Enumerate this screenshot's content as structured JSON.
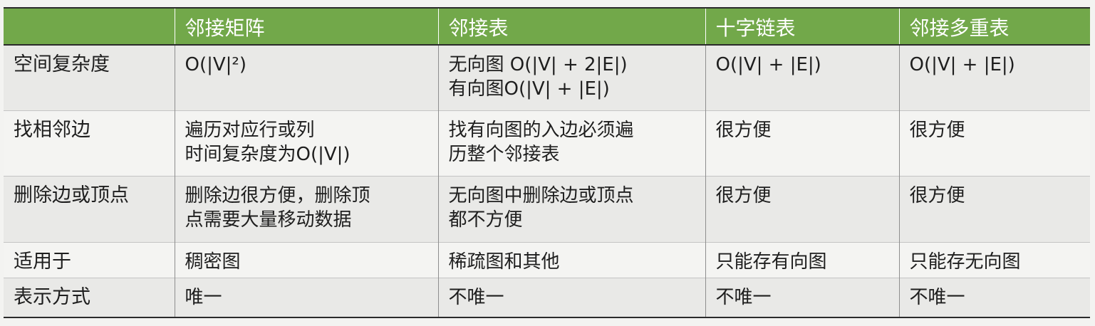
{
  "header": {
    "blank": "",
    "cols": [
      "邻接矩阵",
      "邻接表",
      "十字链表",
      "邻接多重表"
    ]
  },
  "rows": [
    {
      "label": "空间复杂度",
      "cells": [
        [
          "O(|V|²)"
        ],
        [
          "无向图 O(|V| + 2|E|)",
          "有向图O(|V| + |E|)"
        ],
        [
          "O(|V| + |E|)"
        ],
        [
          "O(|V| + |E|)"
        ]
      ]
    },
    {
      "label": "找相邻边",
      "cells": [
        [
          "遍历对应行或列",
          "时间复杂度为O(|V|)"
        ],
        [
          "找有向图的入边必须遍",
          "历整个邻接表"
        ],
        [
          "很方便"
        ],
        [
          "很方便"
        ]
      ]
    },
    {
      "label": "删除边或顶点",
      "cells": [
        [
          "删除边很方便，删除顶",
          "点需要大量移动数据"
        ],
        [
          "无向图中删除边或顶点",
          "都不方便"
        ],
        [
          "很方便"
        ],
        [
          "很方便"
        ]
      ]
    },
    {
      "label": "适用于",
      "cells": [
        [
          "稠密图"
        ],
        [
          "稀疏图和其他"
        ],
        [
          "只能存有向图"
        ],
        [
          "只能存无向图"
        ]
      ]
    },
    {
      "label": "表示方式",
      "cells": [
        [
          "唯一"
        ],
        [
          "不唯一"
        ],
        [
          "不唯一"
        ],
        [
          "不唯一"
        ]
      ]
    }
  ],
  "colors": {
    "header_bg": "#72a84a",
    "header_text": "#ffffff",
    "row_odd_bg": "#e9e9e7",
    "row_even_bg": "#f4f4f2",
    "text": "#1e1e1e"
  }
}
